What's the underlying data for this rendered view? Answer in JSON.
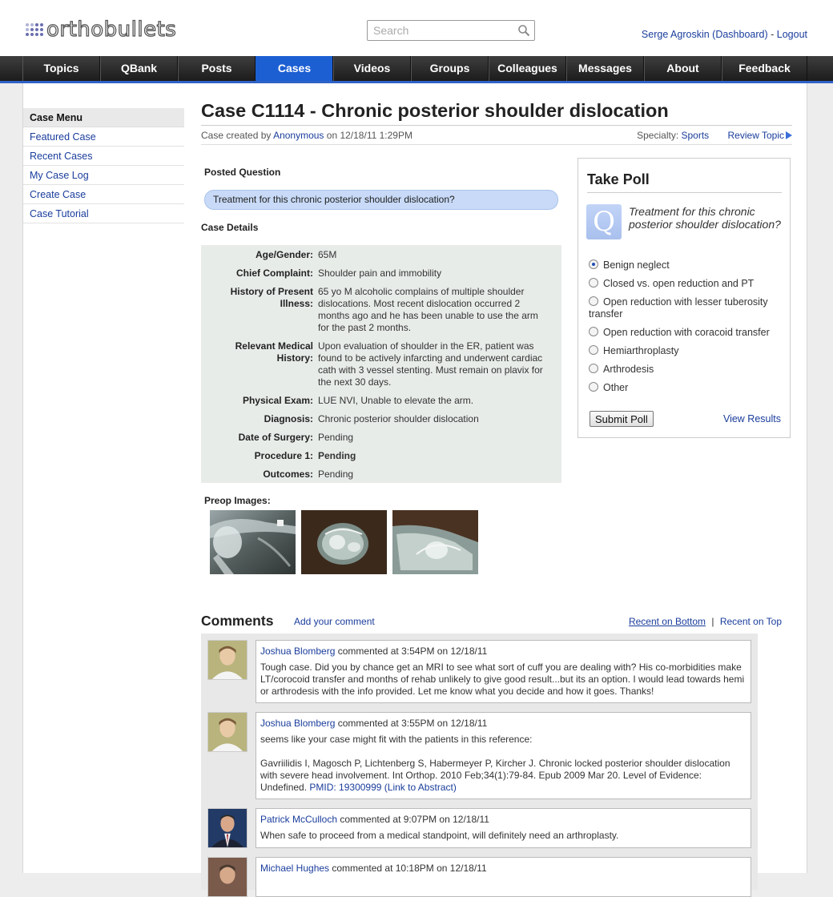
{
  "header": {
    "logo": "orthobullets",
    "search_placeholder": "Search",
    "user_link": "Serge Agroskin (Dashboard)",
    "separator": " - ",
    "logout": "Logout"
  },
  "nav": [
    "Topics",
    "QBank",
    "Posts",
    "Cases",
    "Videos",
    "Groups",
    "Colleagues",
    "Messages",
    "About",
    "Feedback"
  ],
  "nav_active": "Cases",
  "sidebar": {
    "title": "Case Menu",
    "items": [
      "Featured Case",
      "Recent Cases",
      "My Case Log",
      "Create Case",
      "Case Tutorial"
    ]
  },
  "case": {
    "title": "Case C1114 - Chronic posterior shoulder dislocation",
    "created_prefix": "Case created by ",
    "author": "Anonymous",
    "created_suffix": " on 12/18/11 1:29PM",
    "specialty_label": "Specialty: ",
    "specialty": "Sports",
    "review_topic": "Review Topic",
    "posted_question_label": "Posted Question",
    "posted_question": "Treatment for this chronic posterior shoulder dislocation?",
    "case_details_label": "Case Details",
    "details": [
      {
        "k": "Age/Gender:",
        "v": "65M"
      },
      {
        "k": "Chief Complaint:",
        "v": "Shoulder pain and immobility"
      },
      {
        "k": "History of Present Illness:",
        "v": "65 yo M alcoholic complains of multiple shoulder dislocations. Most recent dislocation occurred 2 months ago and he has been unable to use the arm for the past 2 months."
      },
      {
        "k": "Relevant Medical History:",
        "v": "Upon evaluation of shoulder in the ER, patient was found to be actively infarcting and underwent cardiac cath with 3 vessel stenting. Must remain on plavix for the next 30 days."
      },
      {
        "k": "Physical Exam:",
        "v": "LUE NVI, Unable to elevate the arm."
      },
      {
        "k": "Diagnosis:",
        "v": "Chronic posterior shoulder dislocation"
      },
      {
        "k": "Date of Surgery:",
        "v": "Pending"
      },
      {
        "k": "Procedure 1:",
        "v": "Pending"
      },
      {
        "k": "Outcomes:",
        "v": "Pending"
      }
    ],
    "preop_label": "Preop Images:"
  },
  "poll": {
    "title": "Take Poll",
    "question": "Treatment for this chronic posterior shoulder dislocation?",
    "options": [
      "Benign neglect",
      "Closed vs. open reduction and PT",
      "Open reduction with lesser tuberosity transfer",
      "Open reduction with coracoid transfer",
      "Hemiarthroplasty",
      "Arthrodesis",
      "Other"
    ],
    "selected_index": 0,
    "submit": "Submit Poll",
    "view_results": "View Results"
  },
  "comments": {
    "title": "Comments",
    "add": "Add your comment",
    "sort_bottom": "Recent on Bottom",
    "sort_sep": "|",
    "sort_top": "Recent on Top",
    "items": [
      {
        "author": "Joshua Blomberg",
        "time": " commented at 3:54PM on 12/18/11",
        "text": "Tough case. Did you by chance get an MRI to see what sort of cuff you are dealing with? His co-morbidities make LT/corocoid transfer and months of rehab unlikely to give good result...but its an option. I would lead towards hemi or arthrodesis with the info provided. Let me know what you decide and how it goes. Thanks!"
      },
      {
        "author": "Joshua Blomberg",
        "time": " commented at 3:55PM on 12/18/11",
        "text": "seems like your case might fit with the patients in this reference:",
        "ref": "Gavriilidis I, Magosch P, Lichtenberg S, Habermeyer P, Kircher J. Chronic locked posterior shoulder dislocation with severe head involvement. Int Orthop. 2010 Feb;34(1):79-84. Epub 2009 Mar 20. Level of Evidence: Undefined. ",
        "pmid": "PMID: 19300999 (Link to Abstract)"
      },
      {
        "author": "Patrick McCulloch",
        "time": " commented at 9:07PM on 12/18/11",
        "text": "When safe to proceed from a medical standpoint, will definitely need an arthroplasty."
      },
      {
        "author": "Michael Hughes",
        "time": " commented at 10:18PM on 12/18/11",
        "text": ""
      }
    ]
  }
}
